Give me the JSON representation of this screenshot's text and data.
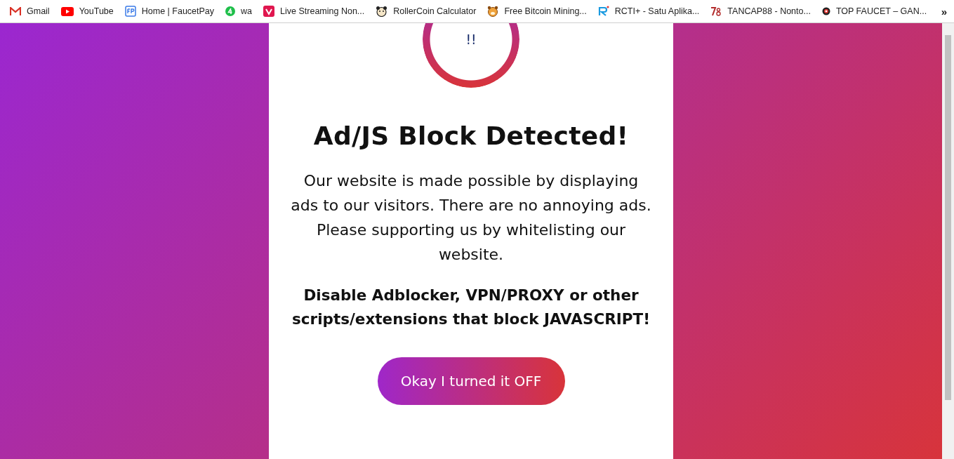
{
  "bookmarks_bar": {
    "items": [
      {
        "label": "Gmail"
      },
      {
        "label": "YouTube"
      },
      {
        "label": "Home | FaucetPay"
      },
      {
        "label": "wa"
      },
      {
        "label": "Live Streaming Non..."
      },
      {
        "label": "RollerCoin Calculator"
      },
      {
        "label": "Free Bitcoin Mining..."
      },
      {
        "label": "RCTI+ - Satu Aplika..."
      },
      {
        "label": "TANCAP88 - Nonto..."
      },
      {
        "label": "TOP FAUCET – GAN..."
      }
    ],
    "overflow": "»"
  },
  "dialog": {
    "icon_text": "!!",
    "title": "Ad/JS Block Detected!",
    "message": "Our website is made possible by displaying ads to our visitors. There are no annoying ads. Please supporting us by whitelisting our website.",
    "warning": "Disable Adblocker, VPN/PROXY or other scripts/extensions that block JAVASCRIPT!",
    "button": "Okay I turned it OFF"
  }
}
